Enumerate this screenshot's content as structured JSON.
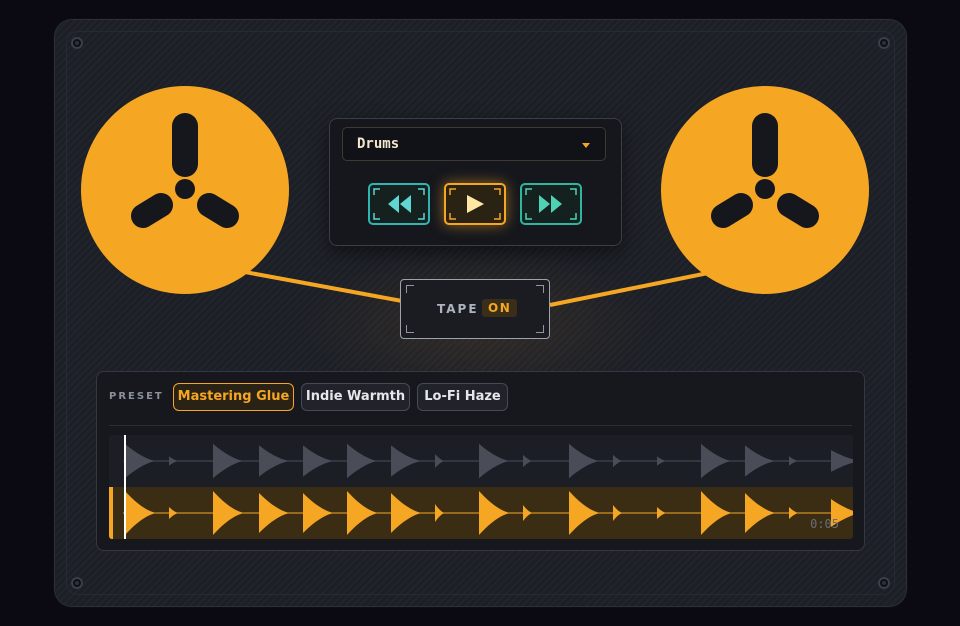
{
  "transport": {
    "track_select": "Drums",
    "buttons": [
      {
        "name": "rewind",
        "icon": "rewind-icon"
      },
      {
        "name": "play",
        "icon": "play-icon",
        "active": true
      },
      {
        "name": "fast-forward",
        "icon": "fast-forward-icon"
      }
    ]
  },
  "tape": {
    "label": "TAPE",
    "state": "ON"
  },
  "presets": {
    "label": "PRESET",
    "items": [
      "Mastering Glue",
      "Indie Warmth",
      "Lo-Fi Haze"
    ],
    "active_index": 0
  },
  "waveform": {
    "time": "0:05"
  },
  "colors": {
    "accent": "#f5a623",
    "teal": "#2fb5b4",
    "panel": "#16181e",
    "device": "#1c1f26"
  },
  "icons": [
    "reel-left-icon",
    "reel-right-icon",
    "dropdown-caret-icon",
    "screw-icon"
  ]
}
